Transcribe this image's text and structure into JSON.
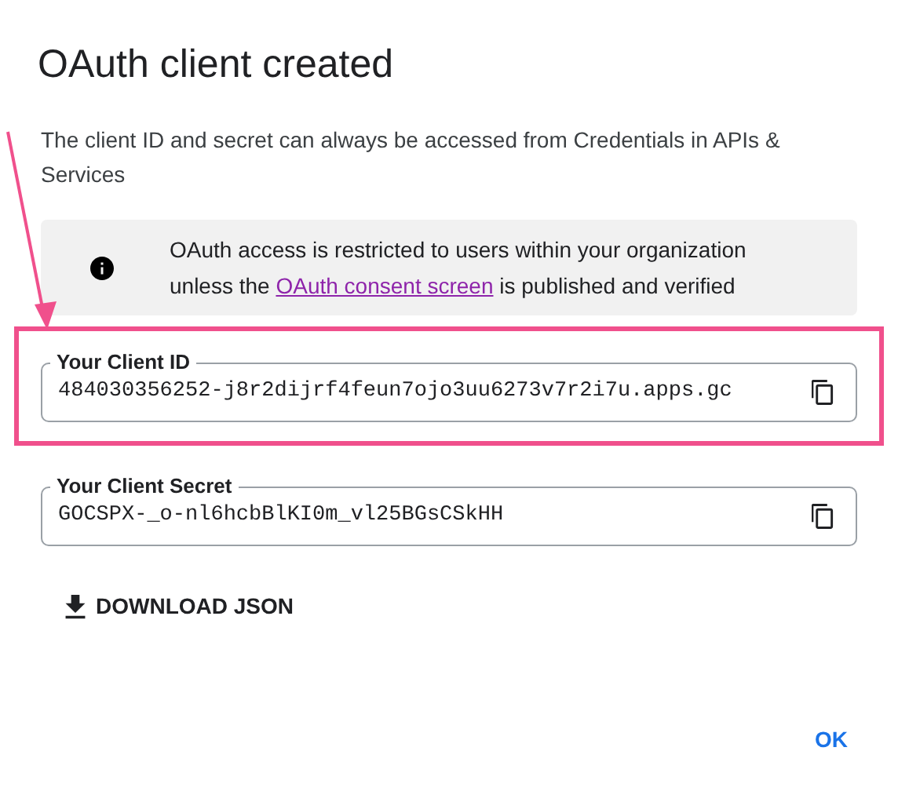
{
  "dialog": {
    "title": "OAuth client created",
    "description": "The client ID and secret can always be accessed from Credentials in APIs & Services",
    "notice": {
      "text_before": "OAuth access is restricted to users within your organization unless the",
      "link": "OAuth consent screen",
      "text_after": "is published and verified"
    },
    "fields": [
      {
        "label": "Your Client ID",
        "value": "484030356252-j8r2dijrf4feun7ojo3uu6273v7r2i7u.apps.gc",
        "highlighted": true
      },
      {
        "label": "Your Client Secret",
        "value": "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",
        "highlighted": false
      }
    ],
    "download_button": "DOWNLOAD JSON",
    "ok_button": "OK"
  }
}
